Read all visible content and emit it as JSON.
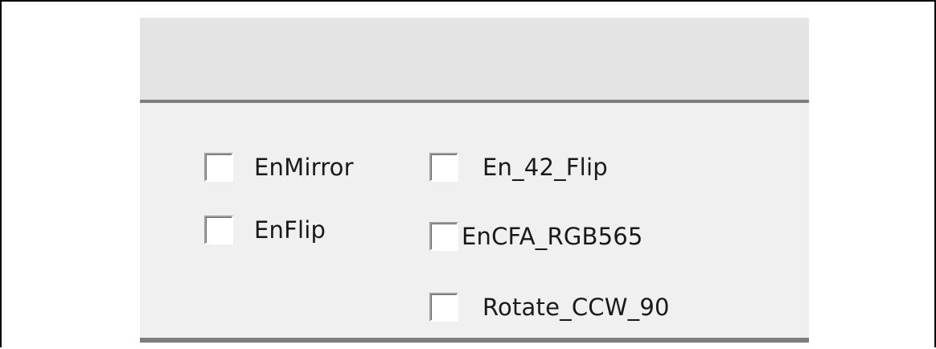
{
  "checkboxes": [
    {
      "label": "EnMirror",
      "checked": false
    },
    {
      "label": "En_42_Flip",
      "checked": false
    },
    {
      "label": "EnFlip",
      "checked": false
    },
    {
      "label": "EnCFA_RGB565",
      "checked": false
    },
    {
      "label": "Rotate_CCW_90",
      "checked": false
    }
  ]
}
